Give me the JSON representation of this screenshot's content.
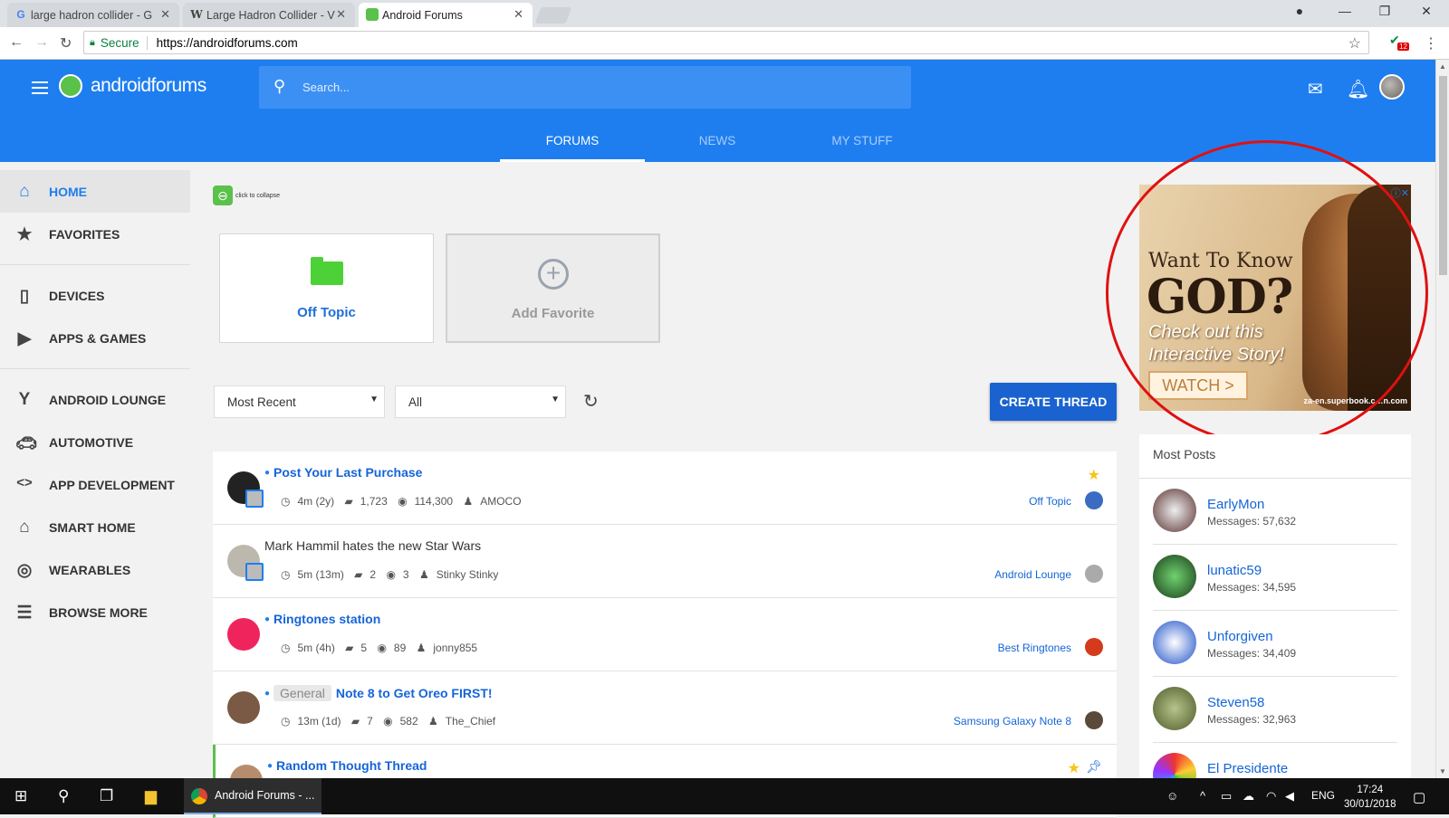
{
  "browser": {
    "tabs": [
      {
        "label": "large hadron collider - G",
        "favicon": "G"
      },
      {
        "label": "Large Hadron Collider - V",
        "favicon": "W"
      },
      {
        "label": "Android Forums",
        "favicon": "androidforums-icon"
      }
    ],
    "secure_label": "Secure",
    "url": "https://androidforums.com",
    "extension_badge": "12"
  },
  "site": {
    "logo_text": "androidforums",
    "search_placeholder": "Search...",
    "nav": [
      "FORUMS",
      "NEWS",
      "MY STUFF"
    ]
  },
  "sidebar": {
    "group1": [
      "HOME",
      "FAVORITES"
    ],
    "group2": [
      "DEVICES",
      "APPS & GAMES"
    ],
    "group3": [
      "ANDROID LOUNGE",
      "AUTOMOTIVE",
      "APP DEVELOPMENT",
      "SMART HOME",
      "WEARABLES",
      "BROWSE MORE"
    ]
  },
  "main": {
    "collapse_label": "click to collapse",
    "favorites": [
      "Off Topic",
      "Add Favorite"
    ],
    "sort_select": "Most Recent",
    "filter_select": "All",
    "create_thread": "CREATE THREAD",
    "threads": [
      {
        "title": "Post Your Last Purchase",
        "prefix": "",
        "time": "4m (2y)",
        "replies": "1,723",
        "views": "114,300",
        "author": "AMOCO",
        "forum": "Off Topic"
      },
      {
        "title": "Mark Hammil hates the new Star Wars",
        "prefix": "",
        "time": "5m (13m)",
        "replies": "2",
        "views": "3",
        "author": "Stinky Stinky",
        "forum": "Android Lounge"
      },
      {
        "title": "Ringtones station",
        "prefix": "",
        "time": "5m (4h)",
        "replies": "5",
        "views": "89",
        "author": "jonny855",
        "forum": "Best Ringtones"
      },
      {
        "title": "Note 8 to Get Oreo FIRST!",
        "prefix": "General",
        "time": "13m (1d)",
        "replies": "7",
        "views": "582",
        "author": "The_Chief",
        "forum": "Samsung Galaxy Note 8"
      },
      {
        "title": "Random Thought Thread",
        "prefix": "",
        "time": "",
        "replies": "",
        "views": "",
        "author": "",
        "forum": ""
      }
    ]
  },
  "ad": {
    "line1": "Want To Know",
    "line2": "GOD?",
    "line3": "Check out this",
    "line4": "Interactive Story!",
    "button": "WATCH >",
    "source": "za-en.superbook.c…n.com"
  },
  "most_posts": {
    "title": "Most Posts",
    "users": [
      {
        "name": "EarlyMon",
        "messages": "Messages: 57,632"
      },
      {
        "name": "lunatic59",
        "messages": "Messages: 34,595"
      },
      {
        "name": "Unforgiven",
        "messages": "Messages: 34,409"
      },
      {
        "name": "Steven58",
        "messages": "Messages: 32,963"
      },
      {
        "name": "El Presidente",
        "messages": ""
      }
    ]
  },
  "taskbar": {
    "app_label": "Android Forums - ...",
    "lang": "ENG",
    "time": "17:24",
    "date": "30/01/2018"
  },
  "colors": {
    "brand_blue": "#1e7ef0",
    "accent_green": "#5ac14b",
    "highlight_red": "#e01010"
  }
}
